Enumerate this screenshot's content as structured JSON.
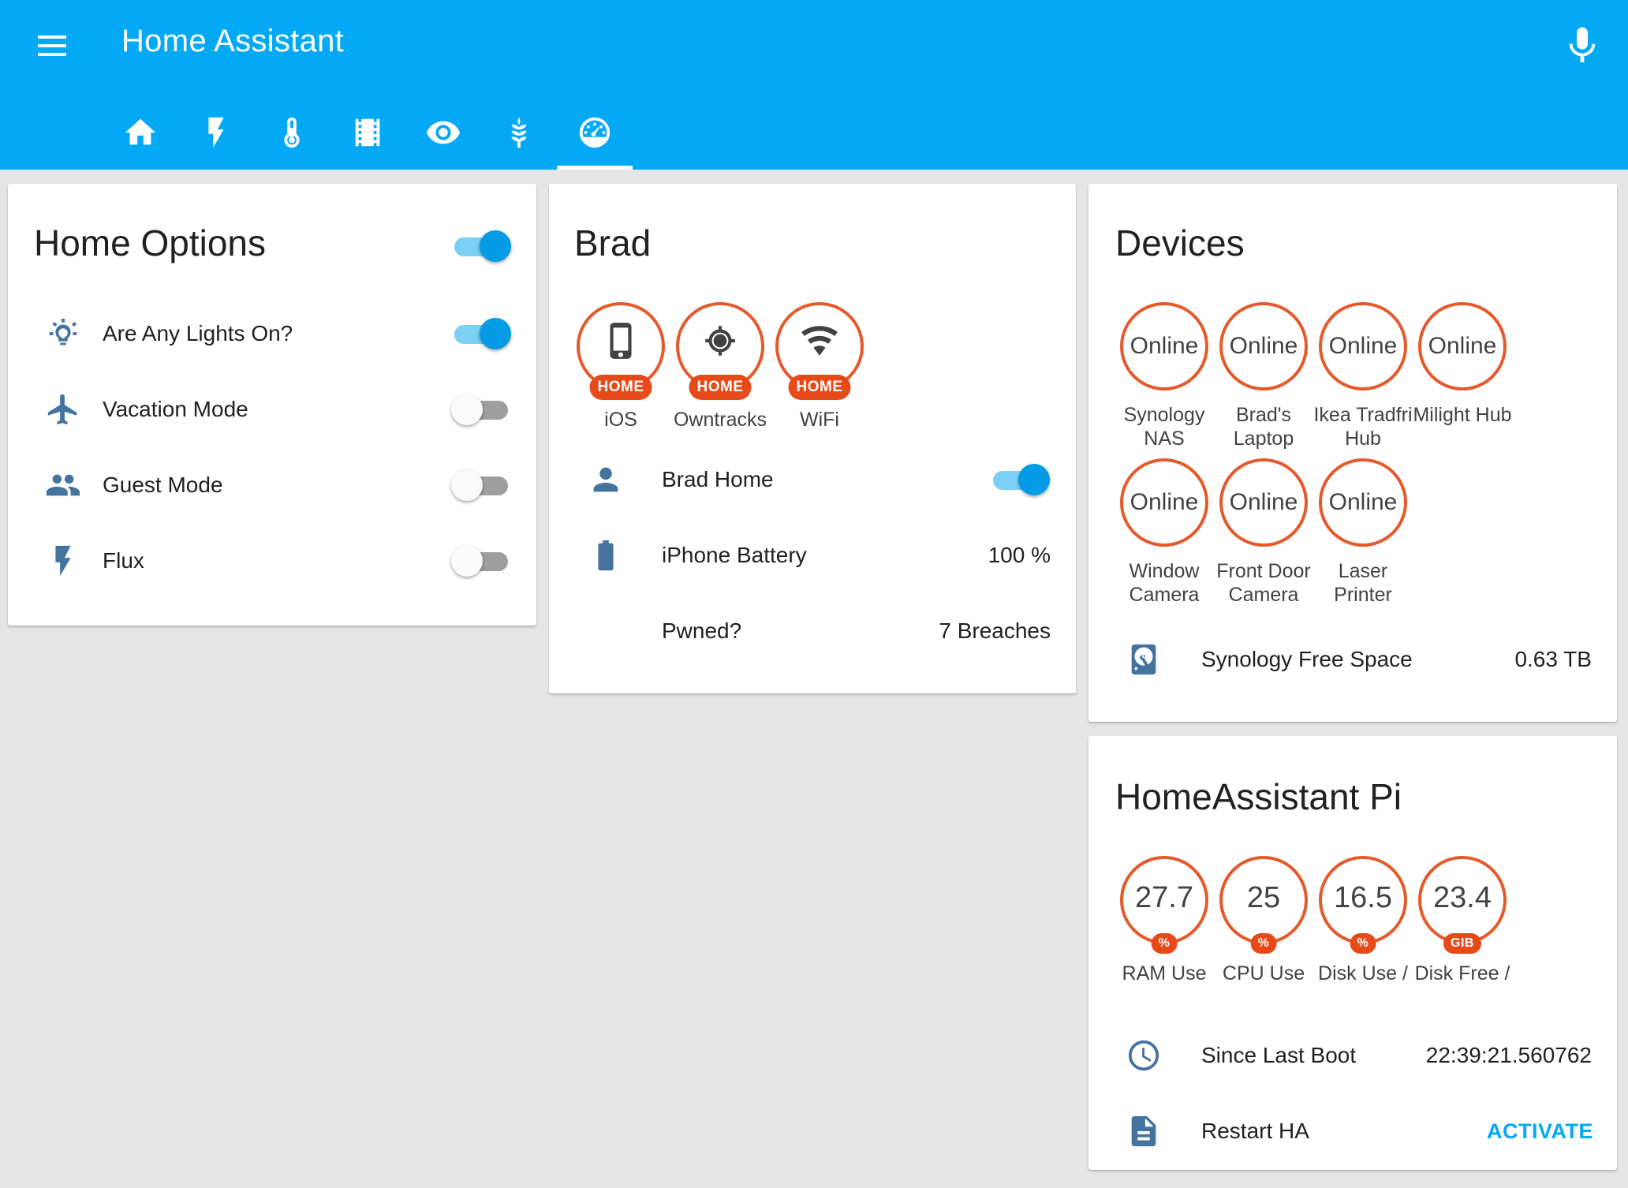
{
  "app": {
    "title": "Home Assistant"
  },
  "header": {
    "tabs": [
      {
        "icon": "home-icon"
      },
      {
        "icon": "flash-icon"
      },
      {
        "icon": "thermometer-icon"
      },
      {
        "icon": "film-icon"
      },
      {
        "icon": "eye-icon"
      },
      {
        "icon": "leaf-icon"
      },
      {
        "icon": "gauge-icon",
        "active": true
      }
    ],
    "mic_icon": "microphone-icon",
    "menu_icon": "menu-icon"
  },
  "home_options": {
    "title": "Home Options",
    "master_toggle": true,
    "items": [
      {
        "label": "Are Any Lights On?",
        "icon": "lightbulb-icon",
        "on": true
      },
      {
        "label": "Vacation Mode",
        "icon": "airplane-icon",
        "on": false
      },
      {
        "label": "Guest Mode",
        "icon": "people-icon",
        "on": false
      },
      {
        "label": "Flux",
        "icon": "flash-icon",
        "on": false
      }
    ]
  },
  "brad": {
    "title": "Brad",
    "badges": [
      {
        "state": "HOME",
        "label": "iOS",
        "icon": "phone-icon"
      },
      {
        "state": "HOME",
        "label": "Owntracks",
        "icon": "crosshairs-icon"
      },
      {
        "state": "HOME",
        "label": "WiFi",
        "icon": "wifi-icon"
      }
    ],
    "rows": {
      "home": {
        "label": "Brad Home",
        "on": true,
        "icon": "person-icon"
      },
      "battery": {
        "label": "iPhone Battery",
        "value": "100 %",
        "icon": "battery-icon"
      },
      "pwned": {
        "label": "Pwned?",
        "value": "7 Breaches"
      }
    }
  },
  "devices": {
    "title": "Devices",
    "badges": [
      {
        "state": "Online",
        "label": "Synology NAS"
      },
      {
        "state": "Online",
        "label": "Brad's Laptop"
      },
      {
        "state": "Online",
        "label": "Ikea Tradfri Hub"
      },
      {
        "state": "Online",
        "label": "Milight Hub"
      },
      {
        "state": "Online",
        "label": "Window Camera"
      },
      {
        "state": "Online",
        "label": "Front Door Camera"
      },
      {
        "state": "Online",
        "label": "Laser Printer"
      }
    ],
    "free_space": {
      "label": "Synology Free Space",
      "value": "0.63 TB",
      "icon": "harddisk-icon"
    }
  },
  "pi": {
    "title": "HomeAssistant Pi",
    "badges": [
      {
        "value": "27.7",
        "unit": "%",
        "label": "RAM Use"
      },
      {
        "value": "25",
        "unit": "%",
        "label": "CPU Use"
      },
      {
        "value": "16.5",
        "unit": "%",
        "label": "Disk Use /"
      },
      {
        "value": "23.4",
        "unit": "GIB",
        "label": "Disk Free /"
      }
    ],
    "boot": {
      "label": "Since Last Boot",
      "value": "22:39:21.560762",
      "icon": "clock-icon"
    },
    "restart": {
      "label": "Restart HA",
      "action": "ACTIVATE",
      "icon": "script-icon"
    }
  },
  "colors": {
    "header": "#03a9f4",
    "badge_border": "#e55a2b",
    "badge_pill": "#e64a19",
    "toggle_on": "#039be5",
    "icon": "#44739e",
    "background": "#e5e5e5"
  }
}
